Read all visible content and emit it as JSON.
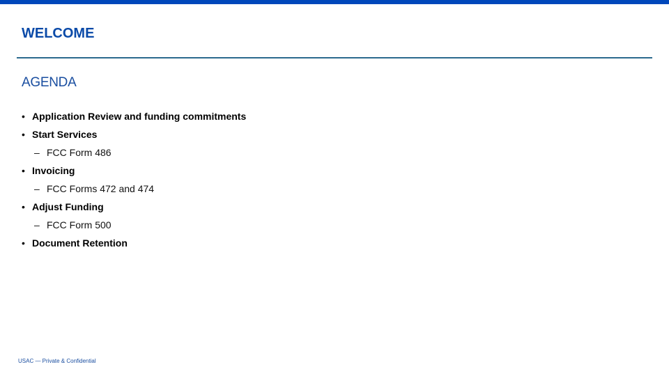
{
  "slide": {
    "title": "WELCOME",
    "subtitle": "AGENDA",
    "agenda_items": [
      {
        "level": 1,
        "text": "Application Review and funding commitments"
      },
      {
        "level": 1,
        "text": "Start Services"
      },
      {
        "level": 2,
        "text": "FCC Form 486"
      },
      {
        "level": 1,
        "text": "Invoicing"
      },
      {
        "level": 2,
        "text": "FCC Forms 472 and 474"
      },
      {
        "level": 1,
        "text": "Adjust Funding"
      },
      {
        "level": 2,
        "text": "FCC Form 500"
      },
      {
        "level": 1,
        "text": "Document Retention"
      }
    ],
    "footer": "USAC — Private & Confidential"
  },
  "colors": {
    "top_bar": "#0047bb",
    "title": "#0a4aa8",
    "divider": "#2b6a8e",
    "subtitle": "#1a4ea0"
  }
}
